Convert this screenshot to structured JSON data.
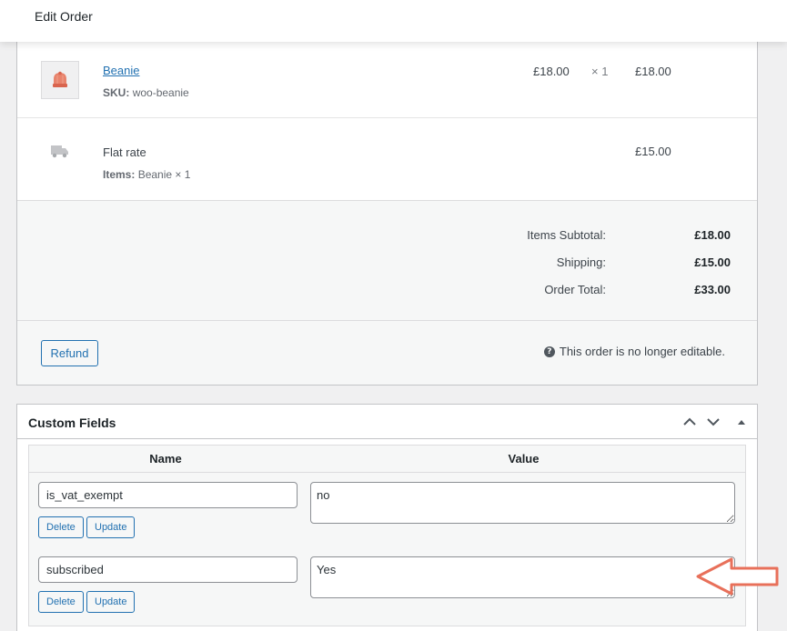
{
  "header": {
    "title": "Edit Order"
  },
  "line_items": [
    {
      "name": "Beanie",
      "sku_label": "SKU:",
      "sku": "woo-beanie",
      "cost": "£18.00",
      "qty": "× 1",
      "total": "£18.00",
      "icon": "beanie-thumbnail"
    }
  ],
  "shipping": {
    "name": "Flat rate",
    "items_label": "Items:",
    "items": "Beanie × 1",
    "total": "£15.00",
    "icon": "truck-icon"
  },
  "totals": {
    "subtotal_label": "Items Subtotal:",
    "subtotal": "£18.00",
    "shipping_label": "Shipping:",
    "shipping": "£15.00",
    "order_total_label": "Order Total:",
    "order_total": "£33.00"
  },
  "actions": {
    "refund_label": "Refund",
    "notice": "This order is no longer editable."
  },
  "custom_fields": {
    "title": "Custom Fields",
    "col_name": "Name",
    "col_value": "Value",
    "rows": [
      {
        "key": "is_vat_exempt",
        "value": "no",
        "delete_label": "Delete",
        "update_label": "Update"
      },
      {
        "key": "subscribed",
        "value": "Yes",
        "delete_label": "Delete",
        "update_label": "Update"
      }
    ]
  },
  "colors": {
    "link": "#2271b1",
    "arrow": "#e8705a",
    "panel_bg": "#f6f7f7",
    "border": "#c3c4c7"
  }
}
